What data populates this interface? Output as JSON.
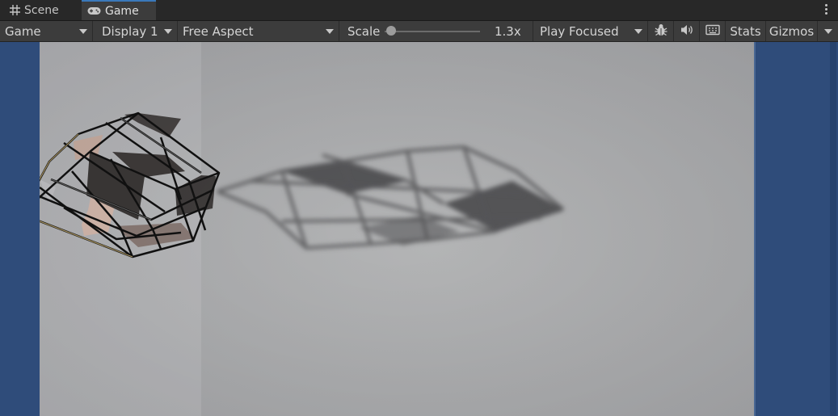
{
  "tabs": [
    {
      "label": "Scene",
      "icon": "grid-icon"
    },
    {
      "label": "Game",
      "icon": "gamepad-icon",
      "active": true
    }
  ],
  "toolbar": {
    "view_mode": "Game",
    "display": "Display 1",
    "aspect": "Free Aspect",
    "scale_label": "Scale",
    "scale_value": "1.3x",
    "play_mode": "Play Focused",
    "stats_label": "Stats",
    "gizmos_label": "Gizmos"
  },
  "colors": {
    "accent": "#3a79bb",
    "background_camera": "#2f4c7a"
  }
}
